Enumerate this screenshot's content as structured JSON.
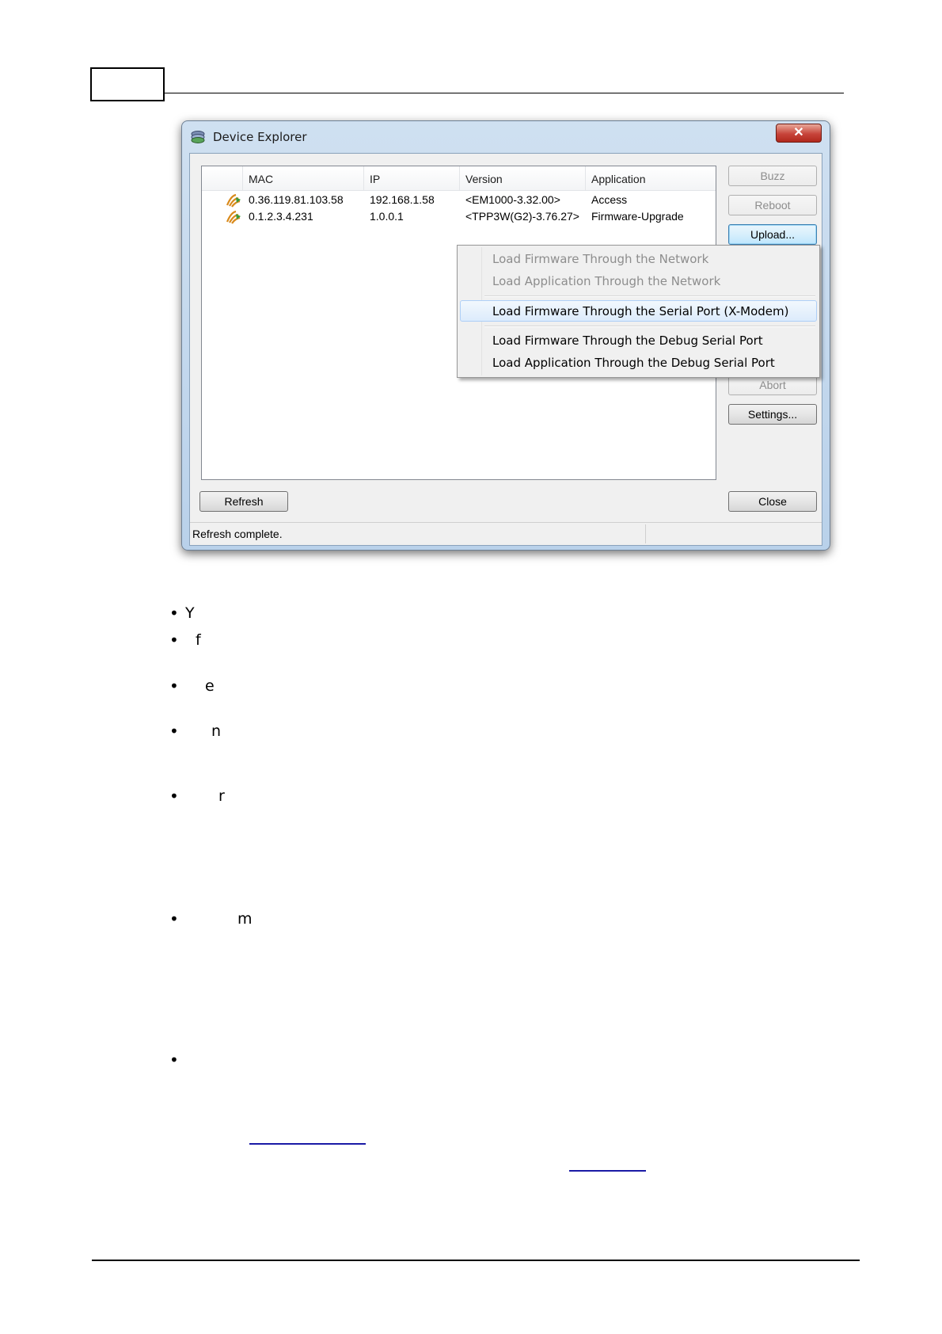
{
  "window": {
    "title": "Device Explorer",
    "close_glyph": "✕",
    "app_icon": "device-explorer-icon"
  },
  "list": {
    "columns": [
      "MAC",
      "IP",
      "Version",
      "Application"
    ],
    "rows": [
      {
        "mac": "0.36.119.81.103.58",
        "ip": "192.168.1.58",
        "version": "<EM1000-3.32.00>",
        "application": "Access",
        "icon": "device-icon"
      },
      {
        "mac": "0.1.2.3.4.231",
        "ip": "1.0.0.1",
        "version": "<TPP3W(G2)-3.76.27>",
        "application": "Firmware-Upgrade",
        "icon": "device-icon"
      }
    ]
  },
  "buttons": {
    "buzz": "Buzz",
    "reboot": "Reboot",
    "upload": "Upload...",
    "abort": "Abort",
    "settings": "Settings...",
    "refresh": "Refresh",
    "close": "Close"
  },
  "menu": {
    "items": [
      "Load Firmware Through the Network",
      "Load Application Through the Network",
      "Load Firmware Through the Serial Port (X-Modem)",
      "Load Firmware Through the Debug Serial Port",
      "Load Application Through the Debug Serial Port"
    ]
  },
  "status": {
    "text": "Refresh complete."
  },
  "body": {
    "bullet_glyph": "•",
    "fragments": [
      "Y",
      "f",
      "e",
      "n",
      "r",
      "m"
    ]
  },
  "colors": {
    "title_bar": "#c4d9ee",
    "menu_highlight": "#dcebfc",
    "close_button": "#c7443a",
    "link": "#1a1aa6"
  }
}
